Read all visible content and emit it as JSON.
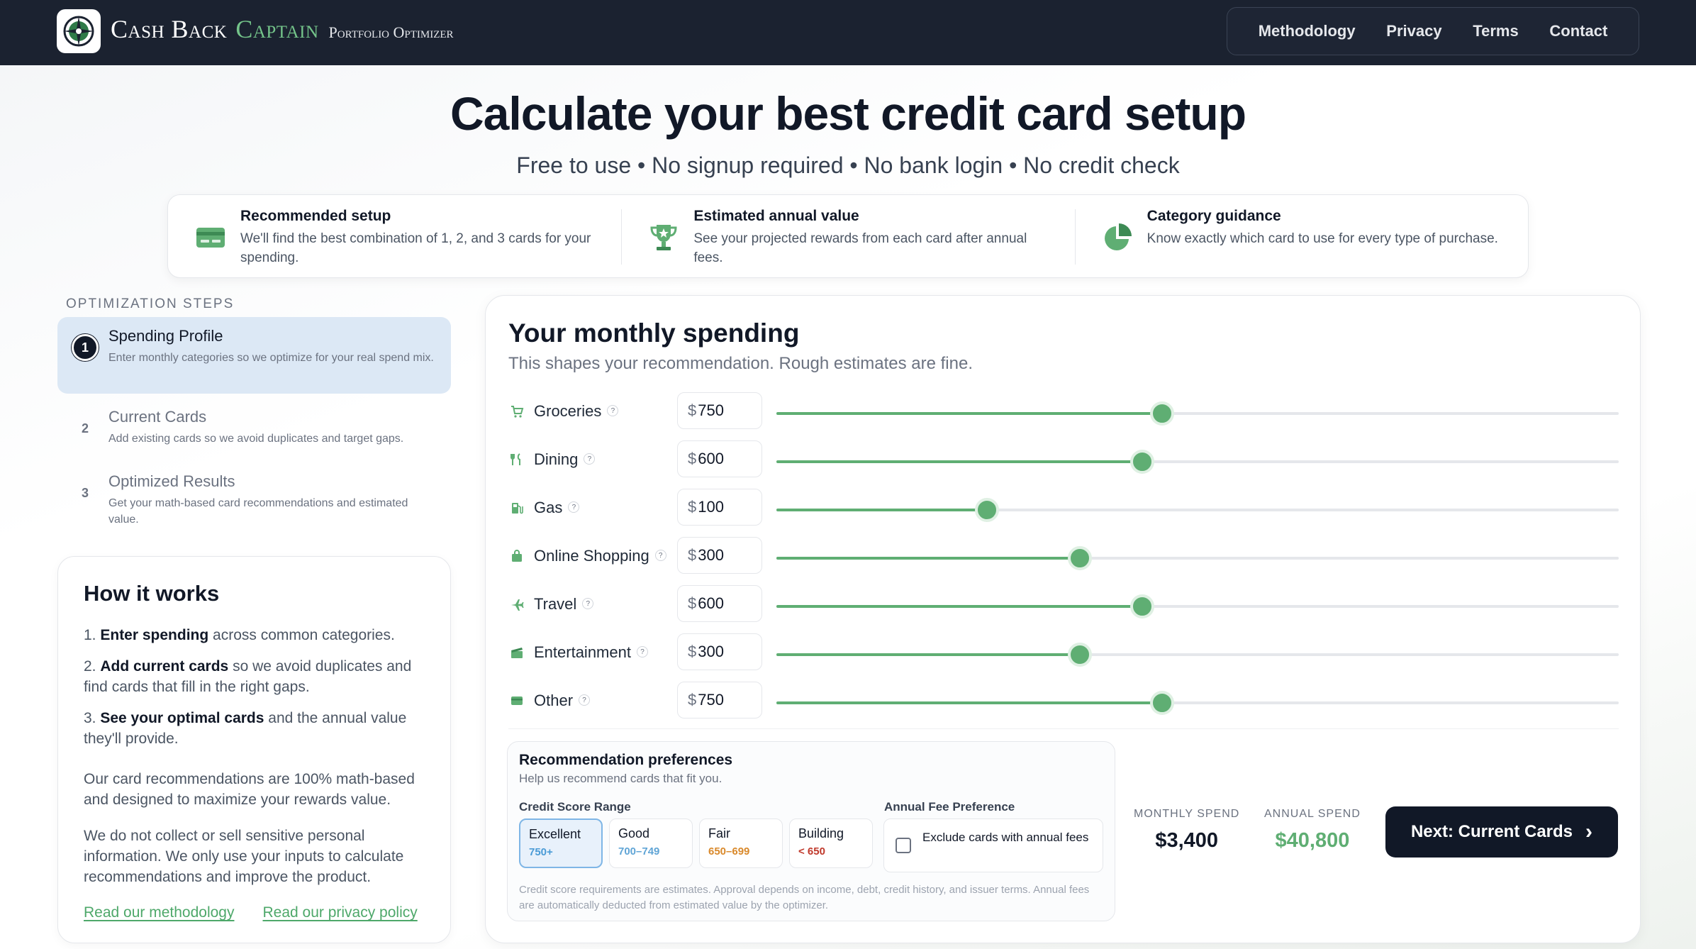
{
  "brand": {
    "name_part1": "Cash Back",
    "name_part2": "Captain",
    "subtitle": "Portfolio Optimizer",
    "accent_color": "#74c48a"
  },
  "nav": {
    "items": [
      "Methodology",
      "Privacy",
      "Terms",
      "Contact"
    ]
  },
  "hero": {
    "title": "Calculate your best credit card setup",
    "subtitle": "Free to use • No signup required • No bank login • No credit check"
  },
  "features": [
    {
      "icon": "credit-card-icon",
      "title": "Recommended setup",
      "text": "We'll find the best combination of 1, 2, and 3 cards for your spending."
    },
    {
      "icon": "trophy-icon",
      "title": "Estimated annual value",
      "text": "See your projected rewards from each card after annual fees."
    },
    {
      "icon": "pie-chart-icon",
      "title": "Category guidance",
      "text": "Know exactly which card to use for every type of purchase."
    }
  ],
  "steps": {
    "label": "OPTIMIZATION STEPS",
    "items": [
      {
        "num": "1",
        "title": "Spending Profile",
        "desc": "Enter monthly categories so we optimize for your real spend mix.",
        "active": true
      },
      {
        "num": "2",
        "title": "Current Cards",
        "desc": "Add existing cards so we avoid duplicates and target gaps.",
        "active": false
      },
      {
        "num": "3",
        "title": "Optimized Results",
        "desc": "Get your math-based card recommendations and estimated value.",
        "active": false
      }
    ]
  },
  "how": {
    "title": "How it works",
    "s1_num": "1.",
    "s1_bold": "Enter spending",
    "s1_rest": " across common categories.",
    "s2_num": "2.",
    "s2_bold": "Add current cards",
    "s2_rest": " so we avoid duplicates and find cards that fill in the right gaps.",
    "s3_num": "3.",
    "s3_bold": "See your optimal cards",
    "s3_rest": " and the annual value they'll provide.",
    "para1": "Our card recommendations are 100% math-based and designed to maximize your rewards value.",
    "para2": "We do not collect or sell sensitive personal information. We only use your inputs to calculate recommendations and improve the product.",
    "link1": "Read our methodology",
    "link2": "Read our privacy policy"
  },
  "spending": {
    "title": "Your monthly spending",
    "lead": "This shapes your recommendation. Rough estimates are fine.",
    "currency": "$",
    "help_glyph": "?",
    "slider_max": 1600,
    "categories": [
      {
        "name": "Groceries",
        "icon": "cart-icon",
        "value": "750"
      },
      {
        "name": "Dining",
        "icon": "utensils-icon",
        "value": "600"
      },
      {
        "name": "Gas",
        "icon": "gas-pump-icon",
        "value": "100"
      },
      {
        "name": "Online Shopping",
        "icon": "bag-icon",
        "value": "300"
      },
      {
        "name": "Travel",
        "icon": "plane-icon",
        "value": "600"
      },
      {
        "name": "Entertainment",
        "icon": "clapper-icon",
        "value": "300"
      },
      {
        "name": "Other",
        "icon": "card-icon",
        "value": "750"
      }
    ],
    "slider_levels": [
      0.458,
      0.434,
      0.25,
      0.36,
      0.434,
      0.36,
      0.458
    ]
  },
  "prefs": {
    "title": "Recommendation preferences",
    "help": "Help us recommend cards that fit you.",
    "credit_label": "Credit Score Range",
    "fee_label": "Annual Fee Preference",
    "credit_options": [
      {
        "label": "Excellent",
        "range": "750+",
        "color": "#4a9bd6",
        "selected": true
      },
      {
        "label": "Good",
        "range": "700–749",
        "color": "#60a5d6",
        "selected": false
      },
      {
        "label": "Fair",
        "range": "650–699",
        "color": "#d9892b",
        "selected": false
      },
      {
        "label": "Building",
        "range": "< 650",
        "color": "#c0392b",
        "selected": false
      }
    ],
    "fee_option": "Exclude cards with annual fees",
    "note": "Credit score requirements are estimates. Approval depends on income, debt, credit history, and issuer terms. Annual fees are automatically deducted from estimated value by the optimizer."
  },
  "totals": {
    "monthly_label": "MONTHLY SPEND",
    "monthly_value": "$3,400",
    "annual_label": "ANNUAL SPEND",
    "annual_value": "$40,800",
    "annual_color": "#5fae73"
  },
  "next_button": {
    "label": "Next: Current Cards",
    "arrow": "›"
  }
}
